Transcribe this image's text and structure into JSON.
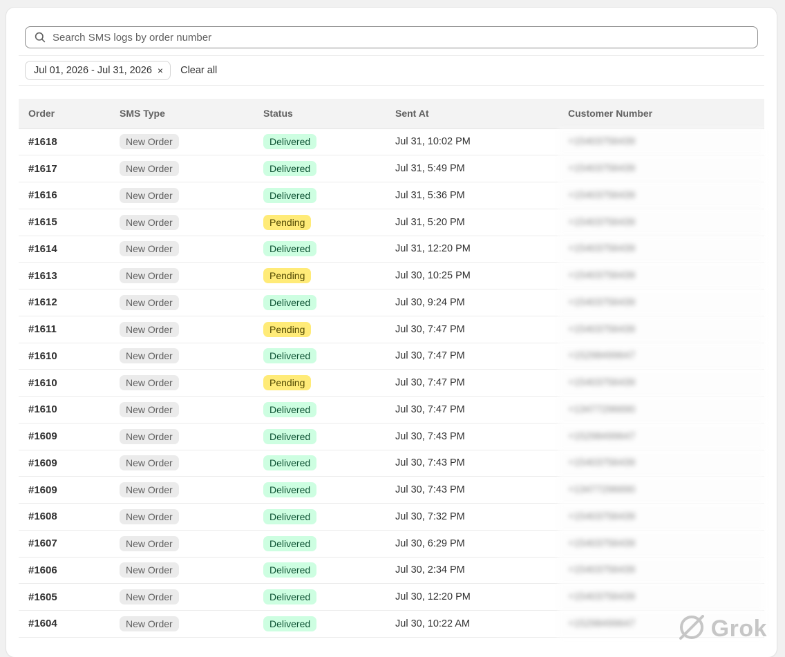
{
  "search": {
    "placeholder": "Search SMS logs by order number",
    "value": ""
  },
  "filters": {
    "date_range": "Jul 01, 2026 - Jul 31, 2026",
    "close_glyph": "×",
    "clear_all": "Clear all"
  },
  "table": {
    "columns": [
      "Order",
      "SMS Type",
      "Status",
      "Sent At",
      "Customer Number"
    ],
    "rows": [
      {
        "order": "#1618",
        "type": "New Order",
        "status": "Delivered",
        "sent_at": "Jul 31, 10:02 PM",
        "phone": "+15403756439"
      },
      {
        "order": "#1617",
        "type": "New Order",
        "status": "Delivered",
        "sent_at": "Jul 31, 5:49 PM",
        "phone": "+15403756439"
      },
      {
        "order": "#1616",
        "type": "New Order",
        "status": "Delivered",
        "sent_at": "Jul 31, 5:36 PM",
        "phone": "+15403756439"
      },
      {
        "order": "#1615",
        "type": "New Order",
        "status": "Pending",
        "sent_at": "Jul 31, 5:20 PM",
        "phone": "+15403756439"
      },
      {
        "order": "#1614",
        "type": "New Order",
        "status": "Delivered",
        "sent_at": "Jul 31, 12:20 PM",
        "phone": "+15403756439"
      },
      {
        "order": "#1613",
        "type": "New Order",
        "status": "Pending",
        "sent_at": "Jul 30, 10:25 PM",
        "phone": "+15403756439"
      },
      {
        "order": "#1612",
        "type": "New Order",
        "status": "Delivered",
        "sent_at": "Jul 30, 9:24 PM",
        "phone": "+15403756439"
      },
      {
        "order": "#1611",
        "type": "New Order",
        "status": "Pending",
        "sent_at": "Jul 30, 7:47 PM",
        "phone": "+15403756439"
      },
      {
        "order": "#1610",
        "type": "New Order",
        "status": "Delivered",
        "sent_at": "Jul 30, 7:47 PM",
        "phone": "+15298499647"
      },
      {
        "order": "#1610",
        "type": "New Order",
        "status": "Pending",
        "sent_at": "Jul 30, 7:47 PM",
        "phone": "+15403756439"
      },
      {
        "order": "#1610",
        "type": "New Order",
        "status": "Delivered",
        "sent_at": "Jul 30, 7:47 PM",
        "phone": "+13477296690"
      },
      {
        "order": "#1609",
        "type": "New Order",
        "status": "Delivered",
        "sent_at": "Jul 30, 7:43 PM",
        "phone": "+15298499647"
      },
      {
        "order": "#1609",
        "type": "New Order",
        "status": "Delivered",
        "sent_at": "Jul 30, 7:43 PM",
        "phone": "+15403756439"
      },
      {
        "order": "#1609",
        "type": "New Order",
        "status": "Delivered",
        "sent_at": "Jul 30, 7:43 PM",
        "phone": "+13477296690"
      },
      {
        "order": "#1608",
        "type": "New Order",
        "status": "Delivered",
        "sent_at": "Jul 30, 7:32 PM",
        "phone": "+15403756439"
      },
      {
        "order": "#1607",
        "type": "New Order",
        "status": "Delivered",
        "sent_at": "Jul 30, 6:29 PM",
        "phone": "+15403756439"
      },
      {
        "order": "#1606",
        "type": "New Order",
        "status": "Delivered",
        "sent_at": "Jul 30, 2:34 PM",
        "phone": "+15403756439"
      },
      {
        "order": "#1605",
        "type": "New Order",
        "status": "Delivered",
        "sent_at": "Jul 30, 12:20 PM",
        "phone": "+15403756439"
      },
      {
        "order": "#1604",
        "type": "New Order",
        "status": "Delivered",
        "sent_at": "Jul 30, 10:22 AM",
        "phone": "+15298499647"
      }
    ]
  },
  "watermark": {
    "text": "Grok",
    "icon": "grok-logo-icon"
  },
  "colors": {
    "delivered_bg": "#cdfee1",
    "delivered_text": "#0c5132",
    "pending_bg": "#ffeb78",
    "pending_text": "#4f4700",
    "type_bg": "#ebebeb"
  }
}
